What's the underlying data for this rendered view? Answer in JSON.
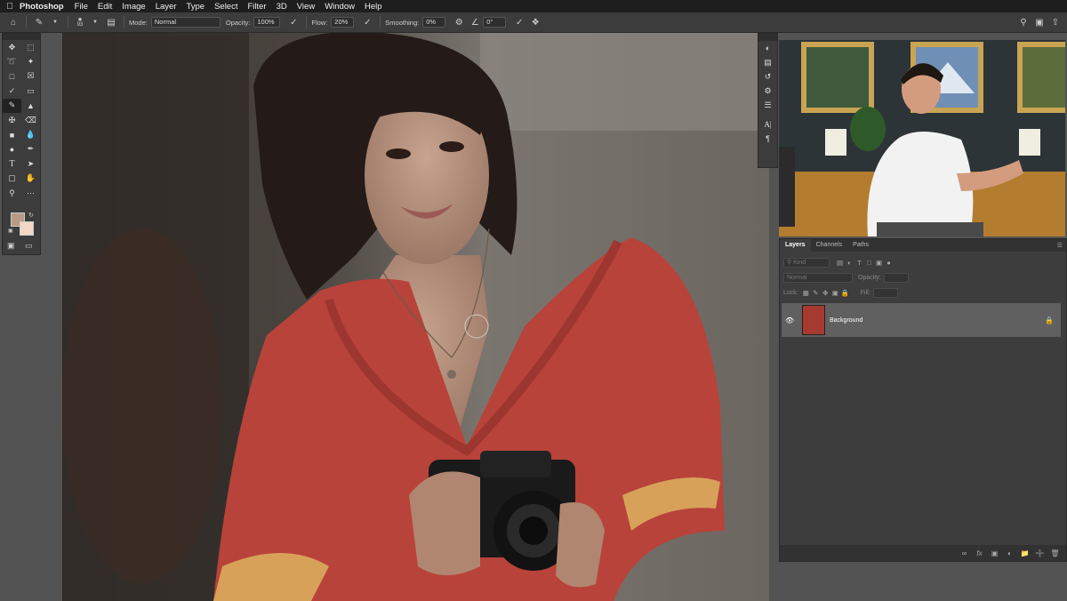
{
  "menubar": {
    "apple_icon": "apple-icon",
    "app_name": "Photoshop",
    "items": [
      "File",
      "Edit",
      "Image",
      "Layer",
      "Type",
      "Select",
      "Filter",
      "3D",
      "View",
      "Window",
      "Help"
    ]
  },
  "options": {
    "brush_size": "93",
    "mode_label": "Mode:",
    "mode_value": "Normal",
    "opacity_label": "Opacity:",
    "opacity_value": "100%",
    "flow_label": "Flow:",
    "flow_value": "20%",
    "smoothing_label": "Smoothing:",
    "smoothing_value": "0%",
    "angle_value": "0°"
  },
  "layers_panel": {
    "tabs": [
      "Layers",
      "Channels",
      "Paths"
    ],
    "kind_placeholder": "Kind",
    "blend_mode": "Normal",
    "opacity_label": "Opacity:",
    "lock_label": "Lock:",
    "fill_label": "Fill:",
    "layer_name": "Background"
  },
  "colors": {
    "foreground": "#b89a85",
    "background": "#f3d6c6",
    "dress": "#b8433a"
  }
}
